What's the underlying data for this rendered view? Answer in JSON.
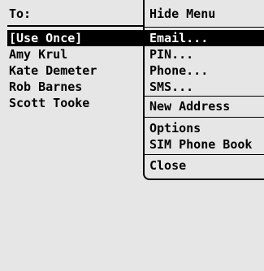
{
  "address_list": {
    "header": "To:",
    "items": [
      {
        "label": "[Use Once]",
        "selected": true
      },
      {
        "label": "Amy Krul",
        "selected": false
      },
      {
        "label": "Kate Demeter",
        "selected": false
      },
      {
        "label": "Rob Barnes",
        "selected": false
      },
      {
        "label": "Scott Tooke",
        "selected": false
      }
    ]
  },
  "menu": {
    "hide_menu": "Hide Menu",
    "email": "Email...",
    "pin": "PIN...",
    "phone": "Phone...",
    "sms": "SMS...",
    "new_address": "New Address",
    "options": "Options",
    "sim_phone_book": "SIM Phone Book",
    "close": "Close"
  },
  "colors": {
    "background": "#e6e6e6",
    "highlight": "#000000",
    "highlight_text": "#ffffff"
  }
}
